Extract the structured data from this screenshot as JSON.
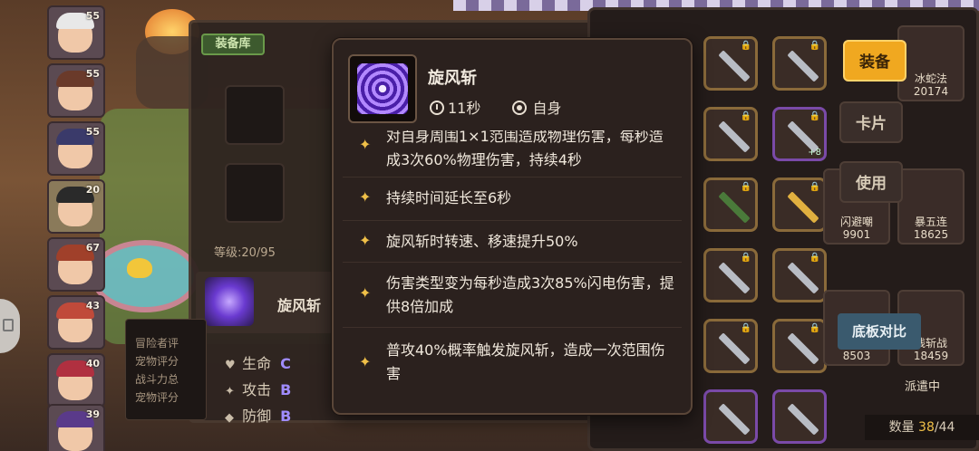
{
  "roster": {
    "levels": [
      "55",
      "55",
      "55",
      "20",
      "67",
      "43",
      "40",
      "39"
    ]
  },
  "equipment": {
    "tab_label": "装备库",
    "level_text": "等级:20/95",
    "skill_name": "旋风斩",
    "info_lines": [
      "冒险者评",
      "宠物评分",
      "战斗力总",
      "宠物评分"
    ],
    "stats": [
      {
        "icon": "heart-icon",
        "label": "生命",
        "grade": "C"
      },
      {
        "icon": "sword-icon",
        "label": "攻击",
        "grade": "B"
      },
      {
        "icon": "shield-icon",
        "label": "防御",
        "grade": "B"
      }
    ]
  },
  "tooltip": {
    "title": "旋风斩",
    "cooldown": "11秒",
    "target": "自身",
    "effects": [
      "对自身周围1×1范围造成物理伤害，每秒造成3次60%物理伤害，持续4秒",
      "持续时间延长至6秒",
      "旋风斩时转速、移速提升50%",
      "伤害类型变为每秒造成3次85%闪电伤害，提供8倍加成",
      "普攻40%概率触发旋风斩，造成一次范围伤害"
    ]
  },
  "right_panel": {
    "equip_button": "装备",
    "card_button": "卡片",
    "use_button": "使用",
    "compare_button": "底板对比",
    "heroes": [
      {
        "name": "冰蛇法",
        "value": "20174"
      },
      {
        "name": "闪避嘲",
        "value": "9901"
      },
      {
        "name": "暴五连",
        "value": "18625"
      },
      {
        "name": "",
        "value": "8503"
      },
      {
        "name": "残斩战",
        "value": "18459"
      }
    ],
    "dispatch_label": "派遣中",
    "count_label": "数量",
    "count_value": "38",
    "count_max": "/44"
  }
}
